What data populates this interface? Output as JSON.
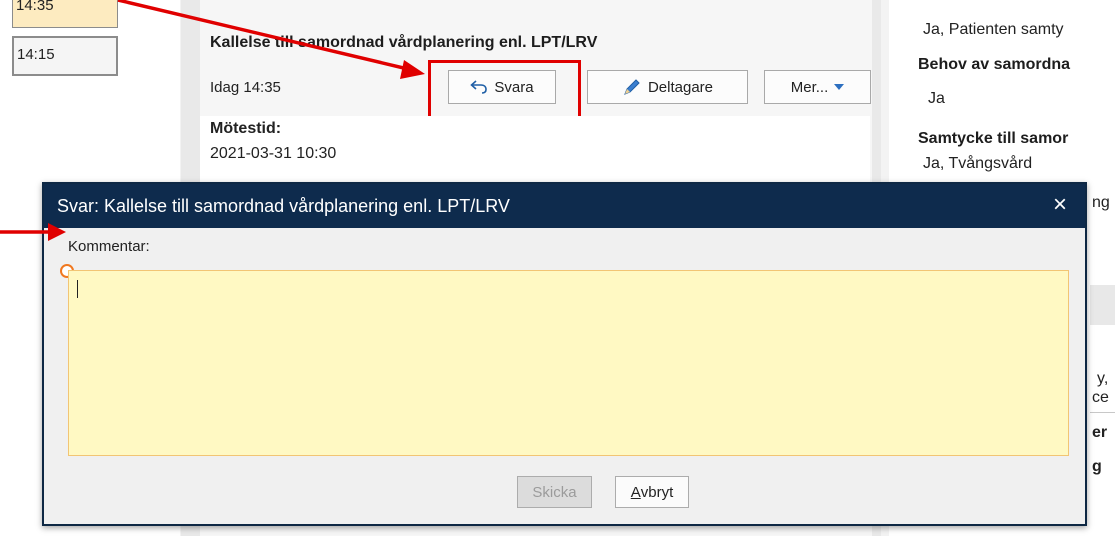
{
  "times": [
    "14:35",
    "14:15"
  ],
  "message": {
    "subject": "Kallelse till samordnad vårdplanering enl. LPT/LRV",
    "date": "Idag 14:35",
    "meeting_label": "Mötestid:",
    "meeting_value": "2021-03-31   10:30",
    "buttons": {
      "reply": "Svara",
      "participants": "Deltagare",
      "more": "Mer..."
    }
  },
  "right": {
    "top_value": "Ja, Patienten samty",
    "label_need": "Behov av samordna",
    "value_need": "Ja",
    "label_consent": "Samtycke till samor",
    "value_consent": "Ja, Tvångsvård",
    "frag1": "ng",
    "frag2": "y,",
    "frag3": "ce",
    "frag4": "er",
    "frag5": "g"
  },
  "dialog": {
    "title": "Svar: Kallelse till samordnad vårdplanering enl. LPT/LRV",
    "comment_label": "Kommentar:",
    "comment_value": "",
    "send_label": "Skicka",
    "cancel_first": "A",
    "cancel_rest": "vbryt",
    "close_icon": "×"
  },
  "colors": {
    "dialog_title_bg": "#0e2b4d",
    "highlight": "#e00000",
    "comment_bg": "#fff9c3",
    "required_marker": "#f07820",
    "selected_time_bg": "#fdebc0"
  }
}
